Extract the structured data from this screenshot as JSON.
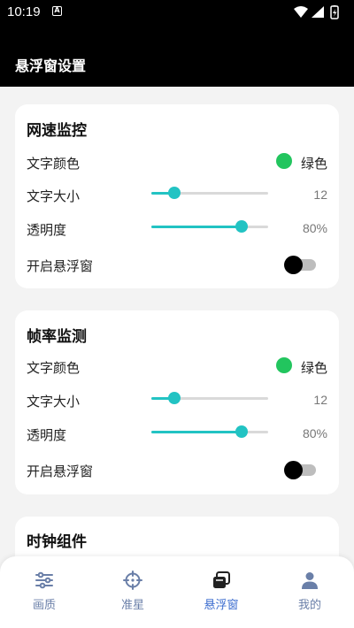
{
  "status_bar": {
    "time": "10:19",
    "notification_letter": "A"
  },
  "app_bar": {
    "title": "悬浮窗设置"
  },
  "cards": [
    {
      "title": "网速监控",
      "text_color_label": "文字颜色",
      "text_color_value": "绿色",
      "text_color_hex": "#22c55e",
      "text_size_label": "文字大小",
      "text_size_value": "12",
      "text_size_level": 0.2,
      "opacity_label": "透明度",
      "opacity_value": "80%",
      "opacity_level": 0.77,
      "toggle_label": "开启悬浮窗",
      "toggle_on": false
    },
    {
      "title": "帧率监测",
      "text_color_label": "文字颜色",
      "text_color_value": "绿色",
      "text_color_hex": "#22c55e",
      "text_size_label": "文字大小",
      "text_size_value": "12",
      "text_size_level": 0.2,
      "opacity_label": "透明度",
      "opacity_value": "80%",
      "opacity_level": 0.77,
      "toggle_label": "开启悬浮窗",
      "toggle_on": false
    },
    {
      "title": "时钟组件"
    }
  ],
  "bottom_nav": {
    "items": [
      {
        "label": "画质",
        "icon": "sliders-icon",
        "active": false
      },
      {
        "label": "准星",
        "icon": "crosshair-icon",
        "active": false
      },
      {
        "label": "悬浮窗",
        "icon": "floating-window-icon",
        "active": true
      },
      {
        "label": "我的",
        "icon": "person-icon",
        "active": false
      }
    ]
  },
  "colors": {
    "accent": "#22c3c3",
    "nav_active": "#3b6ccf",
    "nav_inactive": "#6a7fa8"
  }
}
